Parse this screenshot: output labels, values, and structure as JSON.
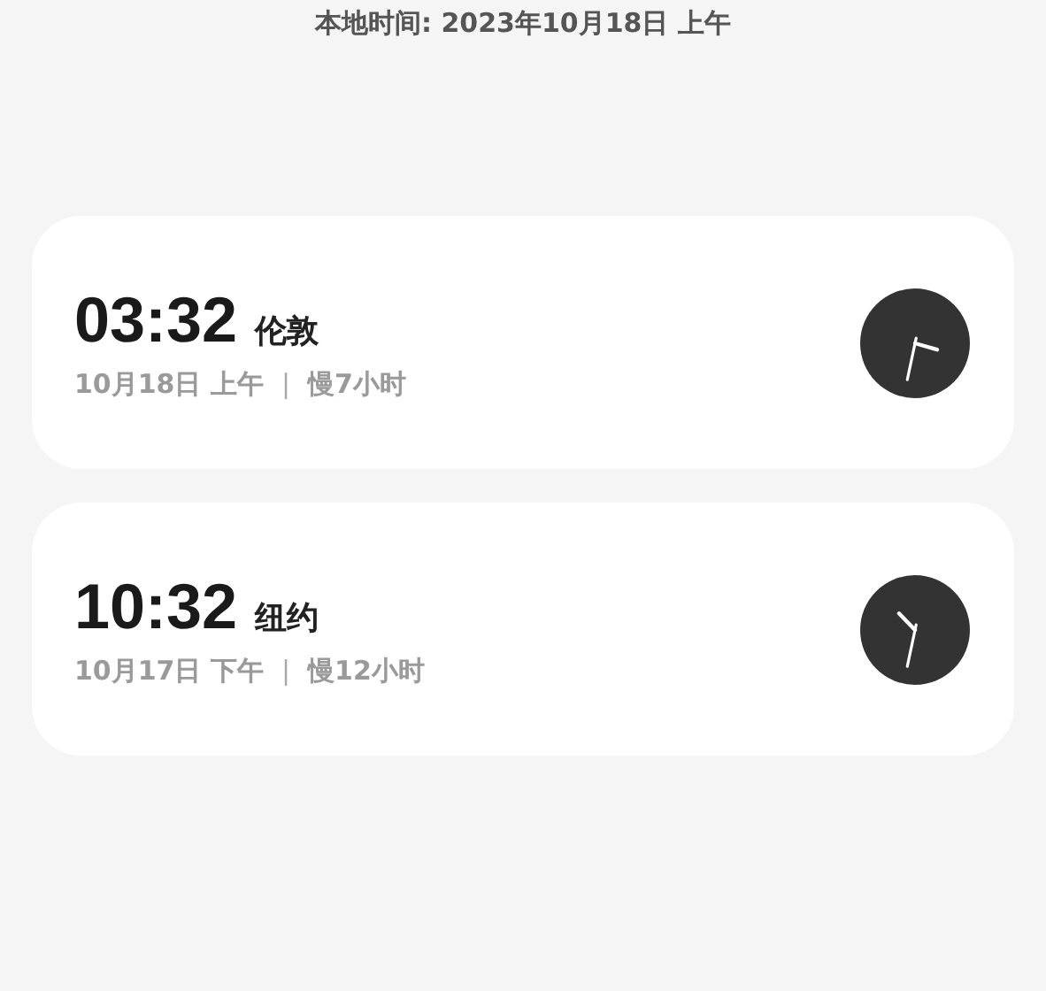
{
  "local_time": "本地时间: 2023年10月18日 上午",
  "cities": [
    {
      "time": "03:32",
      "city": "伦敦",
      "date": "10月18日 上午",
      "separator": "|",
      "offset": "慢7小时"
    },
    {
      "time": "10:32",
      "city": "纽约",
      "date": "10月17日 下午",
      "separator": "|",
      "offset": "慢12小时"
    }
  ]
}
